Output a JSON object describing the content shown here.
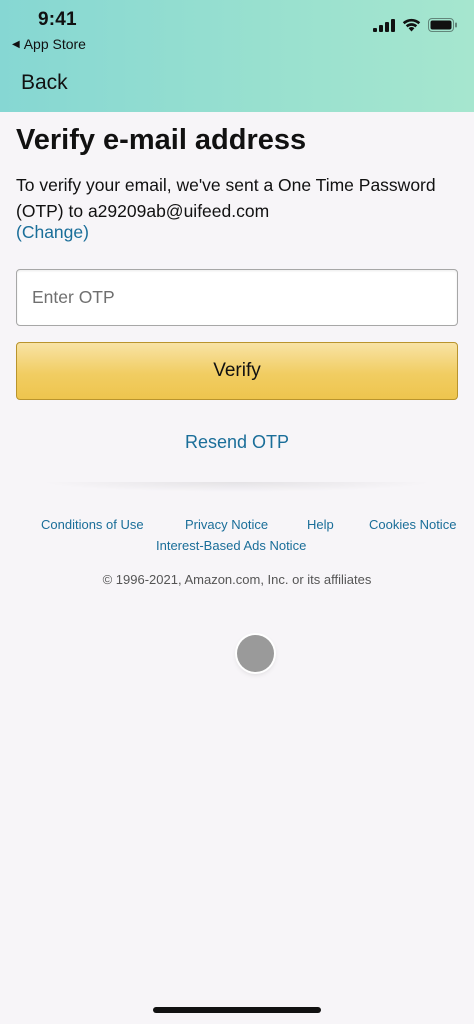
{
  "status_bar": {
    "time": "9:41",
    "back_app": "App Store",
    "icons": [
      "signal-bars-icon",
      "wifi-icon",
      "battery-icon"
    ]
  },
  "nav": {
    "back_label": "Back"
  },
  "main": {
    "title": "Verify e-mail address",
    "description": "To verify your email, we've sent a One Time Password (OTP) to a29209ab@uifeed.com",
    "change_link": "(Change)",
    "otp_placeholder": "Enter OTP",
    "otp_value": "",
    "verify_label": "Verify",
    "resend_label": "Resend OTP"
  },
  "footer": {
    "links": {
      "conditions": "Conditions of Use",
      "privacy": "Privacy Notice",
      "help": "Help",
      "cookies": "Cookies Notice",
      "interest_ads": "Interest-Based Ads Notice"
    },
    "copyright": "© 1996-2021, Amazon.com, Inc. or its affiliates"
  },
  "colors": {
    "header_gradient_start": "#86d7d3",
    "header_gradient_end": "#a6e6cf",
    "link": "#1a6e99",
    "button_yellow": "#f1cd62",
    "background": "#f7f5f8"
  }
}
